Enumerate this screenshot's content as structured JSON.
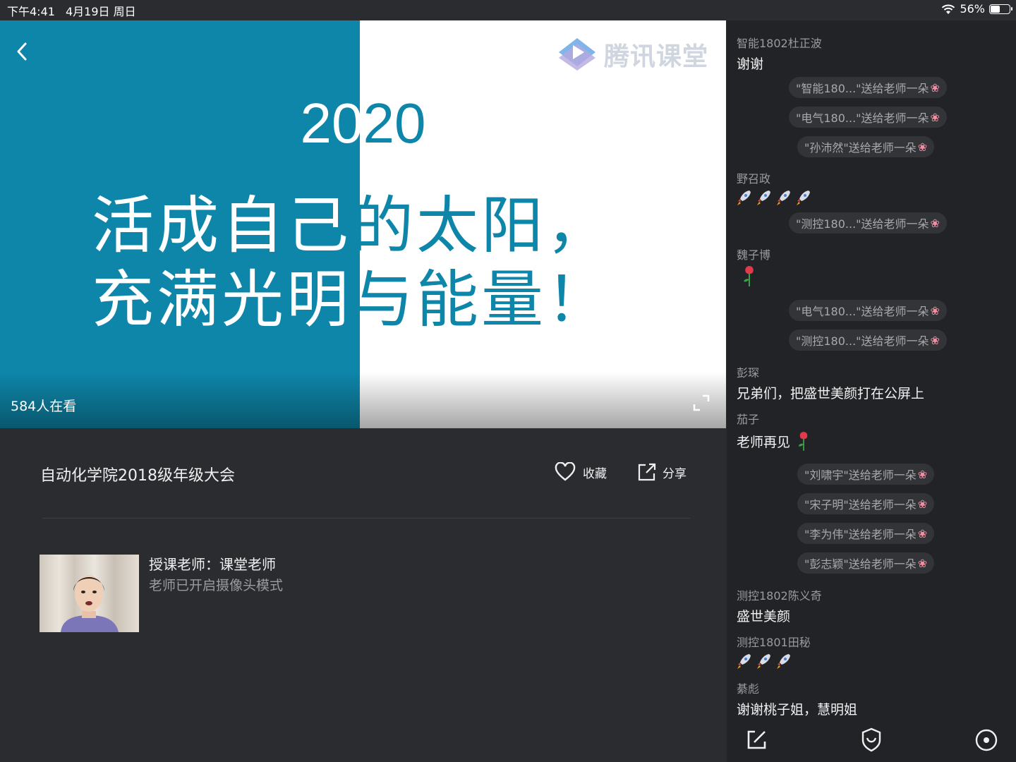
{
  "status_bar": {
    "time": "下午4:41",
    "date": "4月19日 周日",
    "battery": "56%",
    "battery_level": 0.56
  },
  "video": {
    "brand": "腾讯课堂",
    "slide_year": "2020",
    "slide_line1": "活成自己的太阳，",
    "slide_line2": "充满光明与能量！",
    "viewers": "584人在看",
    "colors": {
      "teal": "#0e86a9",
      "white": "#ffffff"
    }
  },
  "course": {
    "title": "自动化学院2018级年级大会",
    "favorite_label": "收藏",
    "share_label": "分享"
  },
  "teacher": {
    "name": "授课老师：课堂老师",
    "status": "老师已开启摄像头模式"
  },
  "chat": {
    "m1": {
      "user": "智能1802杜正波",
      "text": "谢谢"
    },
    "g1": "\"智能180...\"送给老师一朵",
    "g2": "\"电气180...\"送给老师一朵",
    "g3": "\"孙沛然\"送给老师一朵",
    "m2": {
      "user": "野召政"
    },
    "g4": "\"测控180...\"送给老师一朵",
    "m3": {
      "user": "魏子博"
    },
    "g5": "\"电气180...\"送给老师一朵",
    "g6": "\"测控180...\"送给老师一朵",
    "m4": {
      "user": "彭琛",
      "text": "兄弟们，把盛世美颜打在公屏上"
    },
    "m5": {
      "user": "茄子",
      "text": "老师再见"
    },
    "g7": "\"刘啸宇\"送给老师一朵",
    "g8": "\"宋子明\"送给老师一朵",
    "g9": "\"李为伟\"送给老师一朵",
    "g10": "\"彭志颖\"送给老师一朵",
    "m6": {
      "user": "测控1802陈义奇",
      "text": "盛世美颜"
    },
    "m7": {
      "user": "测控1801田秘"
    },
    "m8": {
      "user": "綦彪",
      "text": "谢谢桃子姐，慧明姐"
    }
  }
}
